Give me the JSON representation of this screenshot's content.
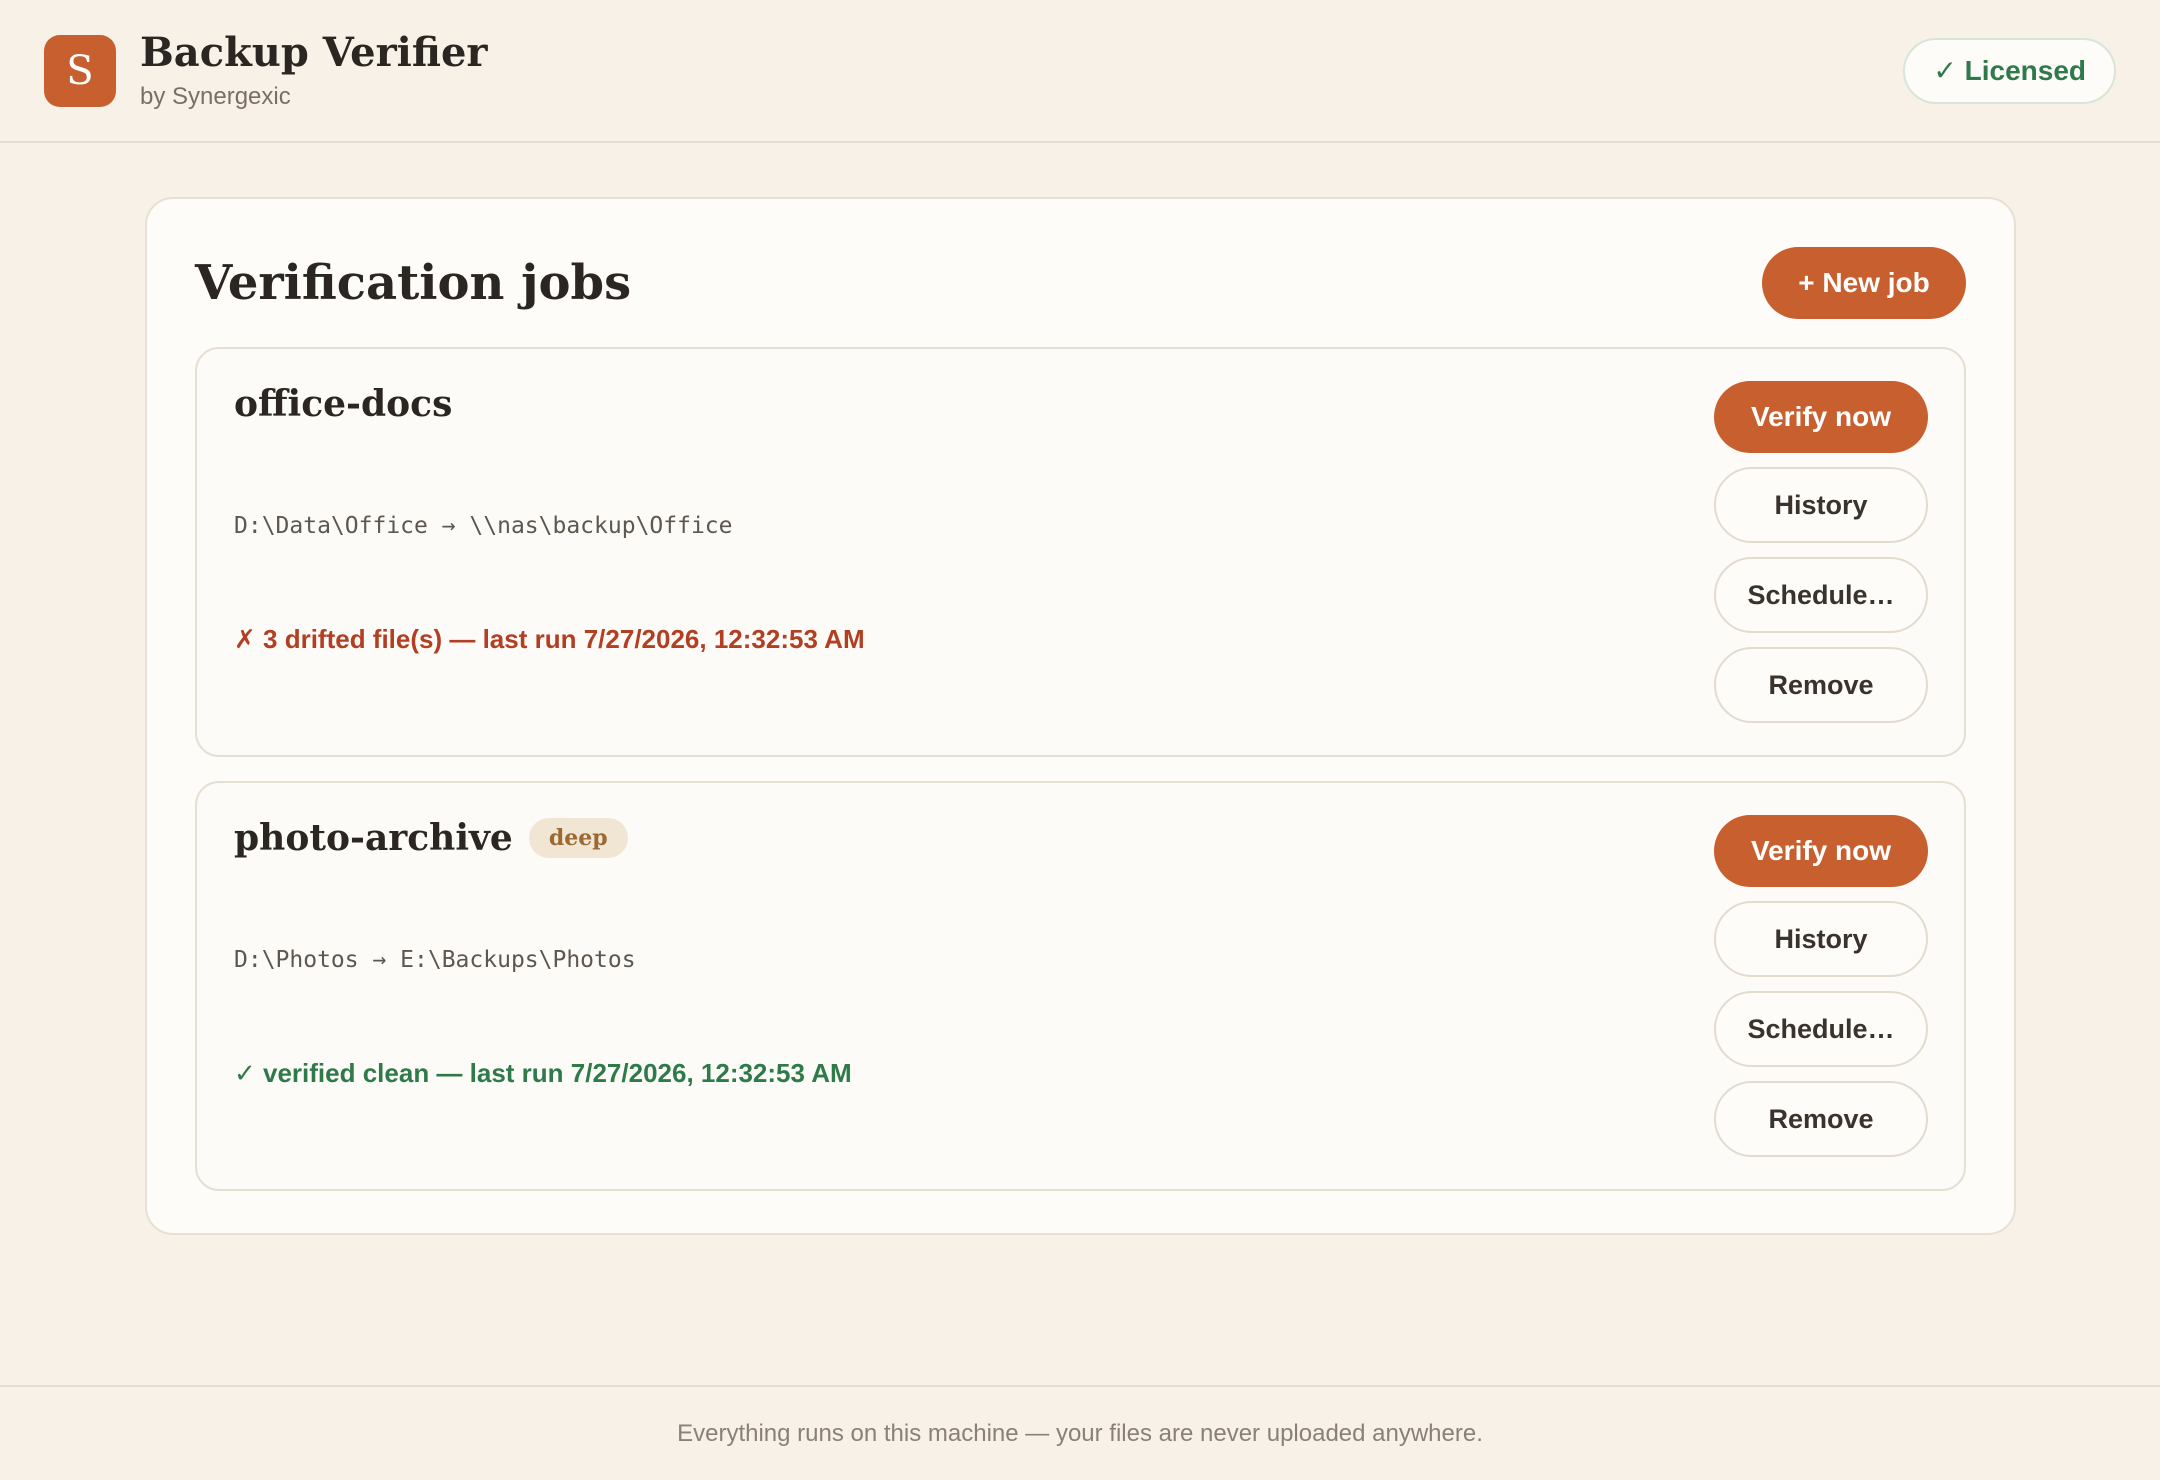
{
  "header": {
    "logo_letter": "S",
    "title": "Backup Verifier",
    "subtitle": "by Synergexic",
    "license_badge": "✓ Licensed"
  },
  "main": {
    "title": "Verification jobs",
    "new_job_label": "+ New job",
    "jobs": [
      {
        "name": "office-docs",
        "tag": "",
        "path": "D:\\Data\\Office → \\\\nas\\backup\\Office",
        "status": "✗ 3 drifted file(s) — last run 7/27/2026, 12:32:53 AM",
        "status_kind": "error",
        "actions": {
          "verify": "Verify now",
          "history": "History",
          "schedule": "Schedule…",
          "remove": "Remove"
        }
      },
      {
        "name": "photo-archive",
        "tag": "deep",
        "path": "D:\\Photos → E:\\Backups\\Photos",
        "status": "✓ verified clean — last run 7/27/2026, 12:32:53 AM",
        "status_kind": "ok",
        "actions": {
          "verify": "Verify now",
          "history": "History",
          "schedule": "Schedule…",
          "remove": "Remove"
        }
      }
    ]
  },
  "footer": {
    "text": "Everything runs on this machine — your files are never uploaded anywhere."
  },
  "colors": {
    "accent": "#c85f2e",
    "background": "#f7f1e8",
    "error": "#b23f22",
    "success": "#2f7a4a"
  }
}
